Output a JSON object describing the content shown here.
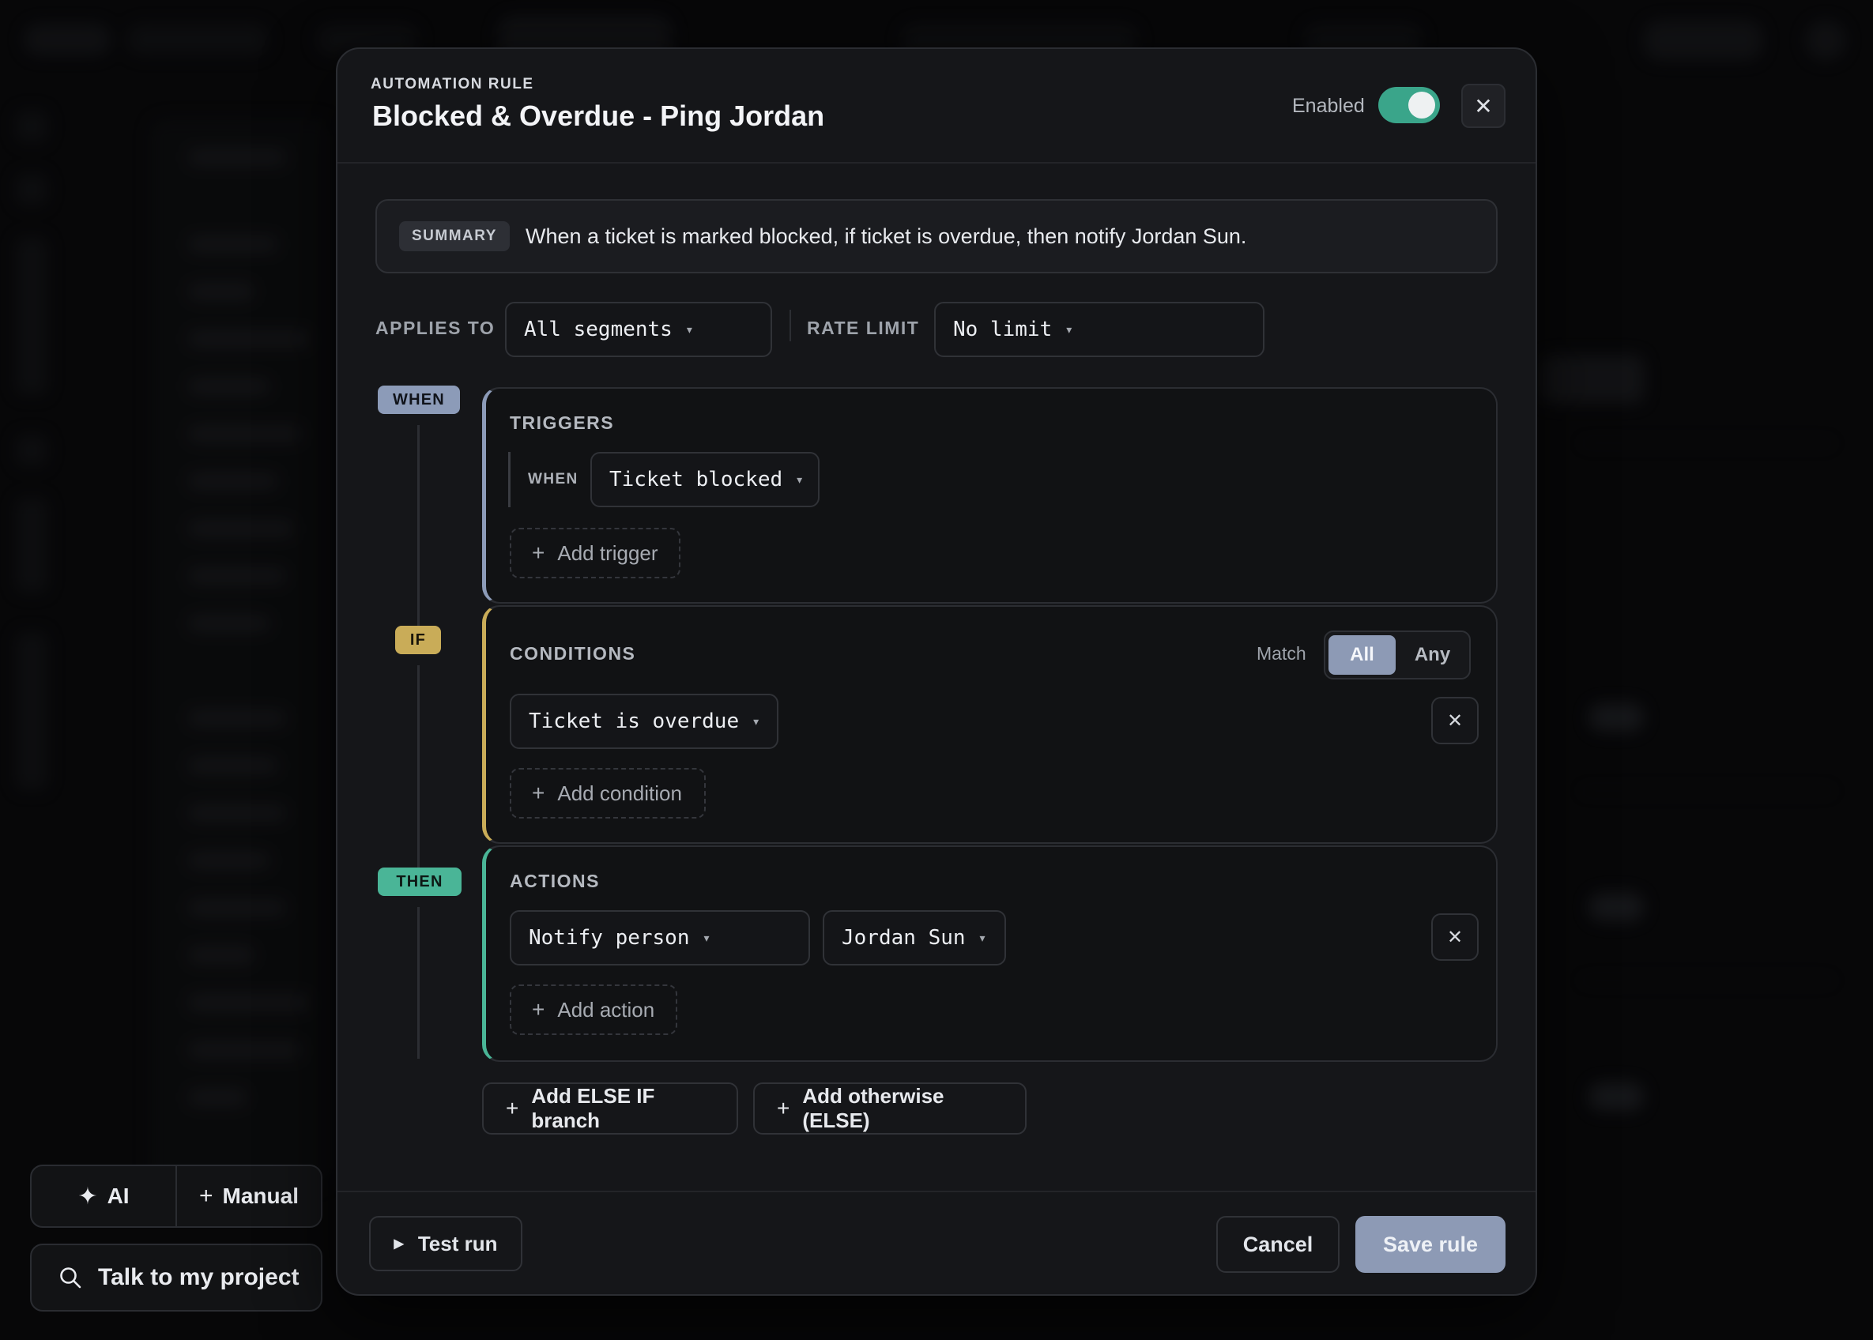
{
  "colors": {
    "accent": "#8d9ab5",
    "toggle_on": "#3aa58a",
    "when_badge": "#8c9bb8",
    "if_badge": "#c9ac58",
    "then_badge": "#4ab597",
    "triggers_border": "#8c9bb8",
    "conditions_border": "#c9ac58",
    "actions_border": "#4ab597"
  },
  "floating": {
    "ai_label": "AI",
    "manual_label": "Manual",
    "talk_label": "Talk to my project",
    "ai_icon": "sparkle-icon",
    "manual_icon": "plus-icon",
    "talk_icon": "search-icon"
  },
  "modal": {
    "eyebrow": "AUTOMATION RULE",
    "title": "Blocked & Overdue - Ping Jordan",
    "enabled_label": "Enabled",
    "enabled": true,
    "close_icon": "close-icon",
    "summary": {
      "badge": "SUMMARY",
      "text": "When a ticket is marked blocked, if ticket is overdue, then notify Jordan Sun."
    },
    "applies_to": {
      "label": "APPLIES TO",
      "value": "All segments"
    },
    "rate_limit": {
      "label": "RATE LIMIT",
      "value": "No limit"
    },
    "steps": {
      "when": "WHEN",
      "if": "IF",
      "then": "THEN"
    },
    "triggers": {
      "title": "TRIGGERS",
      "when_label": "WHEN",
      "value": "Ticket blocked",
      "add_label": "Add trigger"
    },
    "conditions": {
      "title": "CONDITIONS",
      "match_label": "Match",
      "match_options": [
        "All",
        "Any"
      ],
      "match_selected": "All",
      "value": "Ticket is overdue",
      "add_label": "Add condition"
    },
    "actions": {
      "title": "ACTIONS",
      "action_value": "Notify person",
      "person_value": "Jordan Sun",
      "add_label": "Add action"
    },
    "add_else_if": "Add ELSE IF branch",
    "add_else": "Add otherwise (ELSE)",
    "footer": {
      "test_label": "Test run",
      "cancel_label": "Cancel",
      "save_label": "Save rule"
    }
  }
}
